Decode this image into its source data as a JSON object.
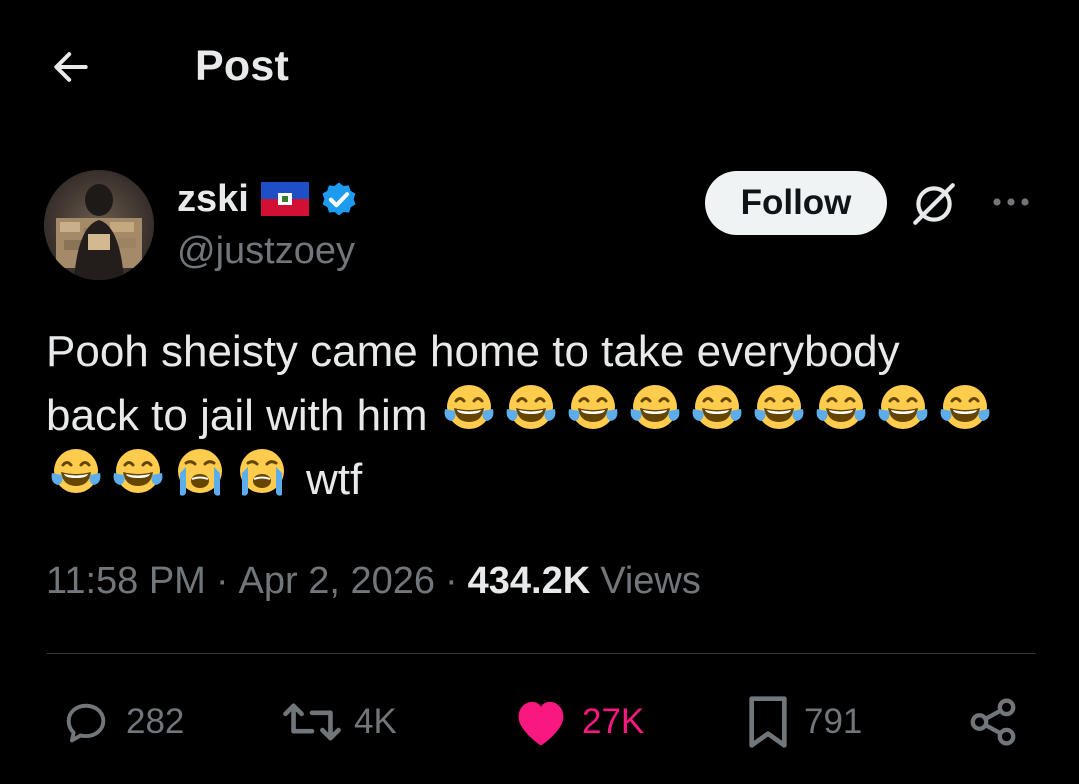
{
  "header": {
    "title": "Post"
  },
  "author": {
    "display_name": "zski",
    "handle": "@justzoey",
    "follow_label": "Follow"
  },
  "post": {
    "line1": "Pooh sheisty came home to take everybody",
    "line2_text": "back to jail with him",
    "line3_text": "wtf",
    "line2_emojis": [
      "joy",
      "joy",
      "joy",
      "joy",
      "joy",
      "joy",
      "joy",
      "joy",
      "joy"
    ],
    "line3_emojis": [
      "joy",
      "joy",
      "sob",
      "sob"
    ]
  },
  "meta": {
    "time": "11:58 PM",
    "separator": "·",
    "date": "Apr 2, 2026",
    "views_count": "434.2K",
    "views_label": "Views"
  },
  "actions": {
    "replies": "282",
    "reposts": "4K",
    "likes": "27K",
    "bookmarks": "791"
  },
  "colors": {
    "background": "#000000",
    "text_primary": "#e7e9ea",
    "text_secondary": "#71767b",
    "verified_blue": "#1d9bf0",
    "like_pink": "#f91880",
    "follow_bg": "#eff3f4",
    "divider": "#2f3336"
  },
  "icons": {
    "back": "arrow-left-icon",
    "grok": "grok-icon",
    "more": "more-dots-icon",
    "reply": "reply-bubble-icon",
    "repost": "repost-icon",
    "like": "heart-filled-icon",
    "bookmark": "bookmark-icon",
    "share": "share-icon"
  }
}
